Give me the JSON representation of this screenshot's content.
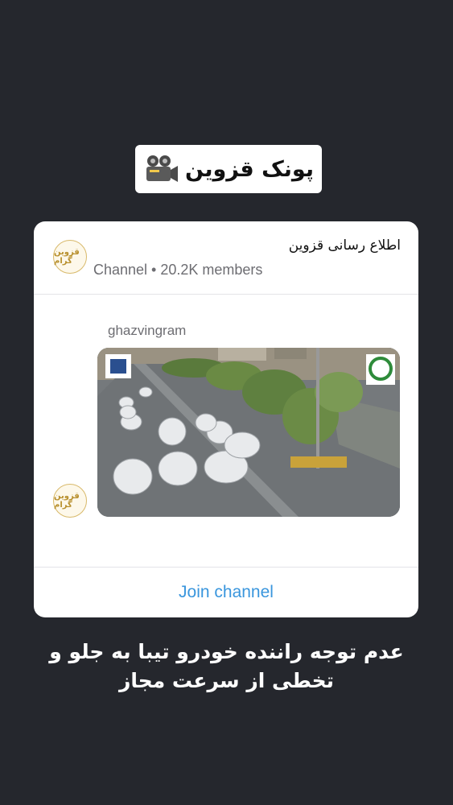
{
  "header": {
    "title": "پونک قزوین",
    "icon": "movie-camera-icon"
  },
  "channel": {
    "name": "اطلاع رسانی قزوین",
    "meta": "Channel • 20.2K members",
    "avatar_text": "قزوین گرام"
  },
  "post": {
    "author": "ghazvingram",
    "image_description_icon": "traffic-camera-photo"
  },
  "join_label": "Join channel",
  "caption": {
    "line1": "عدم توجه راننده خودرو تیبا به جلو و",
    "line2": "تخطی از سرعت مجاز"
  },
  "colors": {
    "background": "#25272d",
    "card": "#ffffff",
    "link": "#3a96dd",
    "meta": "#6d6d72"
  }
}
